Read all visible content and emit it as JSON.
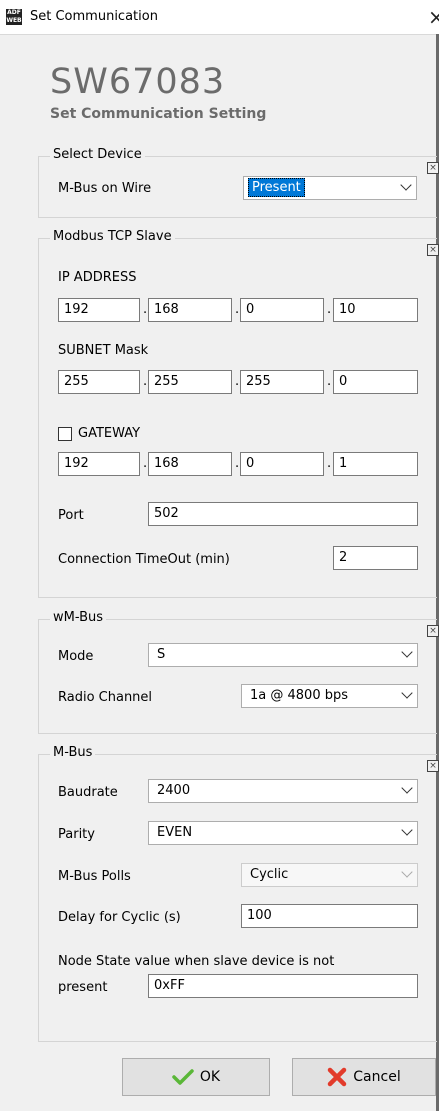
{
  "window": {
    "title": "Set Communication",
    "app_icon_text": "ADF WEB"
  },
  "header": {
    "product": "SW67083",
    "subtitle": "Set Communication Setting"
  },
  "select_device": {
    "legend": "Select Device",
    "mbus_on_wire_label": "M-Bus on Wire",
    "mbus_on_wire_value": "Present"
  },
  "modbus": {
    "legend": "Modbus TCP Slave",
    "ip_label": "IP ADDRESS",
    "ip": [
      "192",
      "168",
      "0",
      "10"
    ],
    "subnet_label": "SUBNET Mask",
    "subnet": [
      "255",
      "255",
      "255",
      "0"
    ],
    "gateway_label": "GATEWAY",
    "gateway_checked": false,
    "gateway": [
      "192",
      "168",
      "0",
      "1"
    ],
    "port_label": "Port",
    "port": "502",
    "timeout_label": "Connection TimeOut (min)",
    "timeout": "2"
  },
  "wmbus": {
    "legend": "wM-Bus",
    "mode_label": "Mode",
    "mode": "S",
    "radio_label": "Radio Channel",
    "radio": "1a @ 4800 bps"
  },
  "mbus": {
    "legend": "M-Bus",
    "baudrate_label": "Baudrate",
    "baudrate": "2400",
    "parity_label": "Parity",
    "parity": "EVEN",
    "polls_label": "M-Bus Polls",
    "polls": "Cyclic",
    "delay_label": "Delay for Cyclic (s)",
    "delay": "100",
    "node_state_label": "Node State value when slave device is not",
    "node_state_label2": "present",
    "node_state": "0xFF"
  },
  "buttons": {
    "ok": "OK",
    "cancel": "Cancel"
  },
  "colors": {
    "check": "#5ab738",
    "cancel_x": "#e23b2b",
    "highlight": "#0078d7"
  }
}
